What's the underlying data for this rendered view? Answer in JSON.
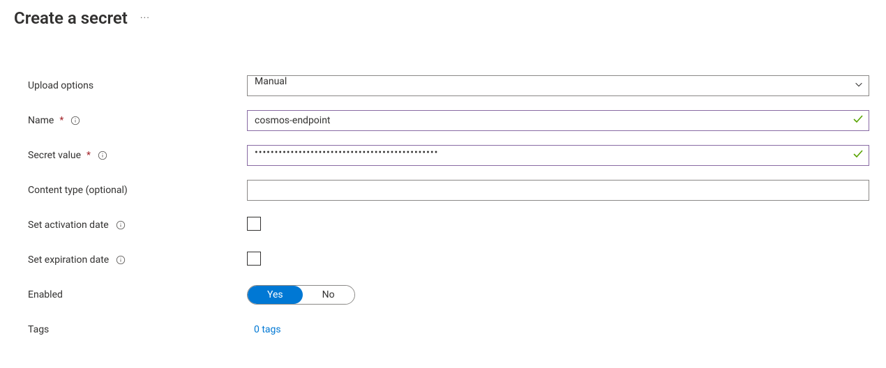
{
  "header": {
    "title": "Create a secret"
  },
  "form": {
    "upload_options": {
      "label": "Upload options",
      "value": "Manual"
    },
    "name": {
      "label": "Name",
      "value": "cosmos-endpoint",
      "required": true
    },
    "secret_value": {
      "label": "Secret value",
      "masked": "••••••••••••••••••••••••••••••••••••••••••••••",
      "required": true
    },
    "content_type": {
      "label": "Content type (optional)",
      "value": ""
    },
    "activation_date": {
      "label": "Set activation date",
      "checked": false
    },
    "expiration_date": {
      "label": "Set expiration date",
      "checked": false
    },
    "enabled": {
      "label": "Enabled",
      "value": "Yes",
      "options": {
        "yes": "Yes",
        "no": "No"
      }
    },
    "tags": {
      "label": "Tags",
      "link_text": "0 tags"
    }
  }
}
